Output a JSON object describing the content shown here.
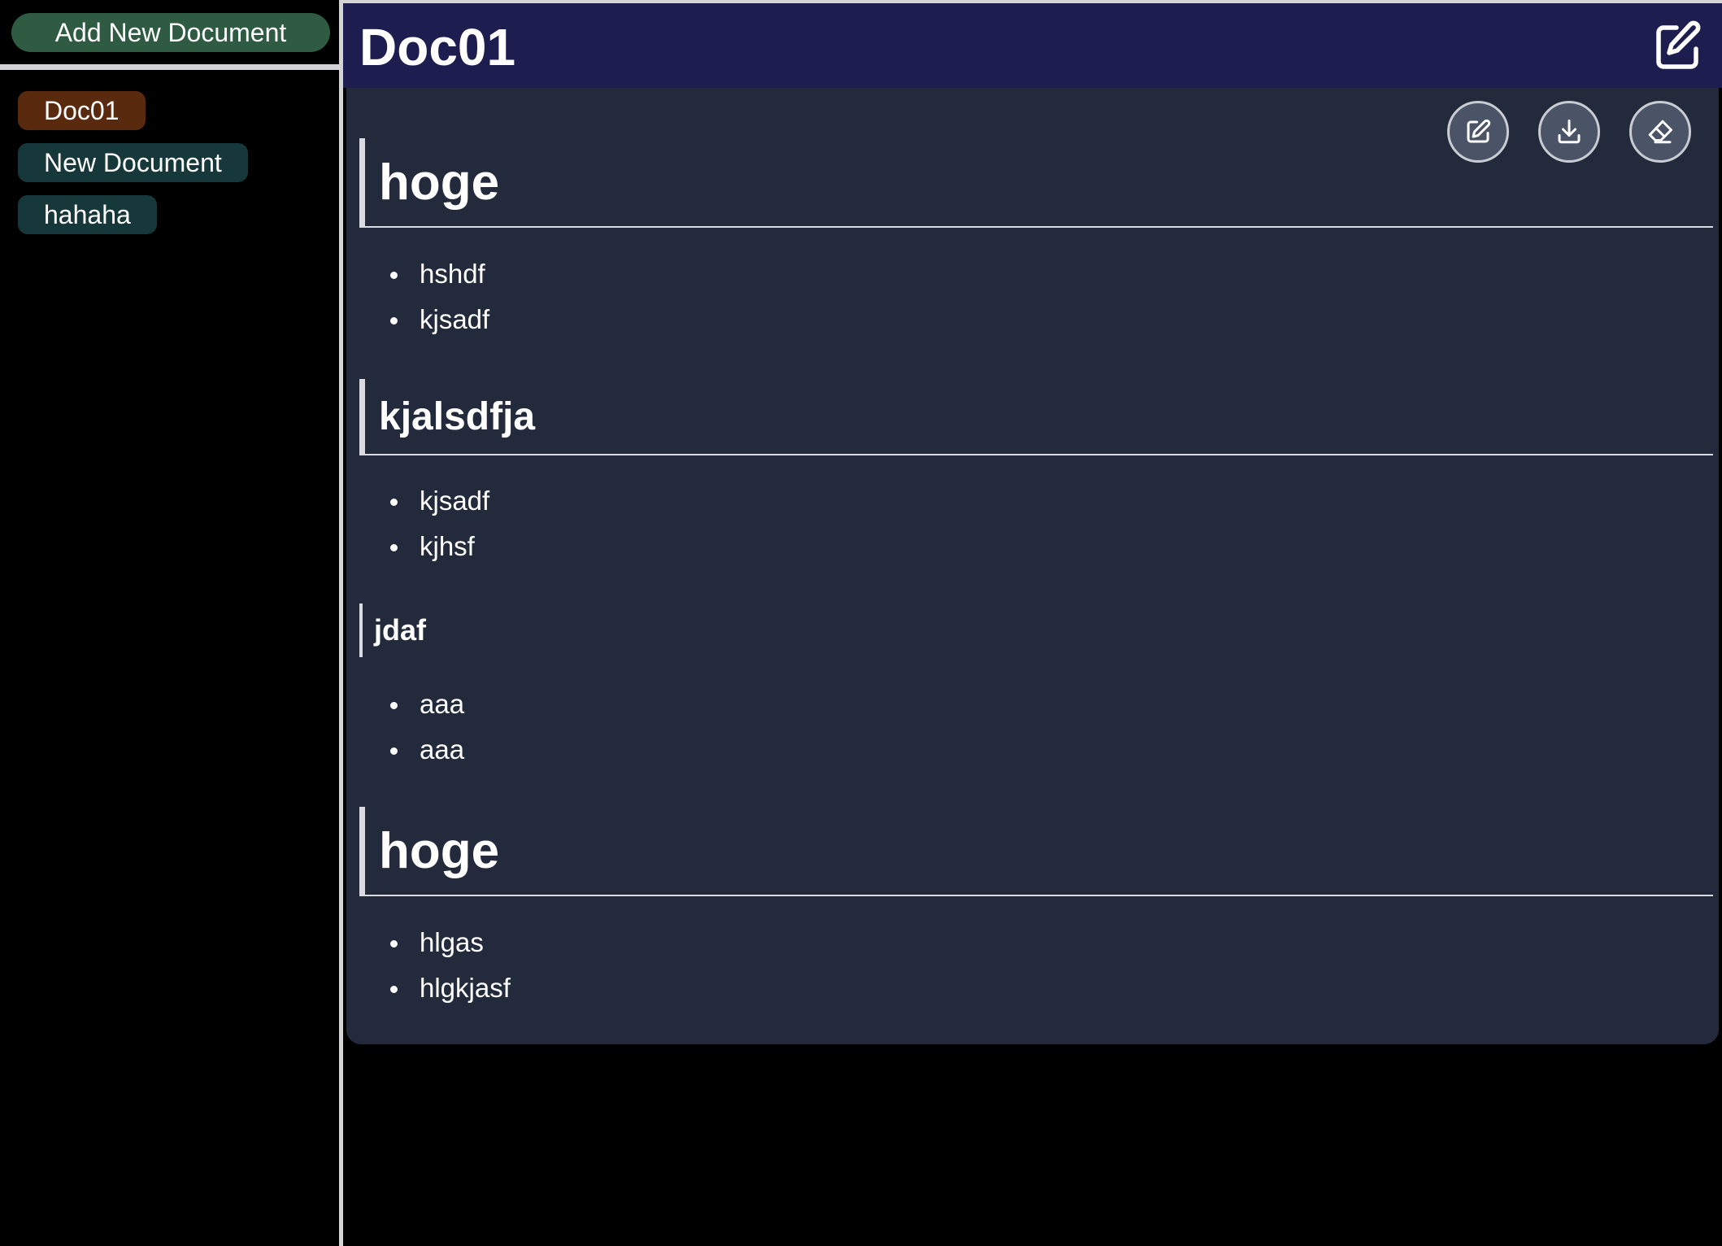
{
  "sidebar": {
    "add_button": "Add New Document",
    "documents": [
      {
        "label": "Doc01",
        "active": true
      },
      {
        "label": "New Document",
        "active": false
      },
      {
        "label": "hahaha",
        "active": false
      }
    ]
  },
  "header": {
    "title": "Doc01",
    "icon": "edit-square-icon"
  },
  "toolbar": {
    "icons": [
      "pencil-icon",
      "download-icon",
      "eraser-icon"
    ]
  },
  "content": {
    "sections": [
      {
        "level": 1,
        "heading": "hoge",
        "items": [
          "hshdf",
          "kjsadf"
        ]
      },
      {
        "level": 2,
        "heading": "kjalsdfja",
        "items": [
          "kjsadf",
          "kjhsf"
        ]
      },
      {
        "level": 3,
        "heading": "jdaf",
        "items": [
          "aaa",
          "aaa"
        ]
      },
      {
        "level": 1,
        "heading": "hoge",
        "items": [
          "hlgas",
          "hlgkjasf"
        ]
      }
    ]
  },
  "colors": {
    "header_bg": "#1d1d4f",
    "content_bg": "#222a3b",
    "add_button_bg": "#2f5b43",
    "active_doc_bg": "#5a2a0f",
    "doc_bg": "#17383a"
  }
}
